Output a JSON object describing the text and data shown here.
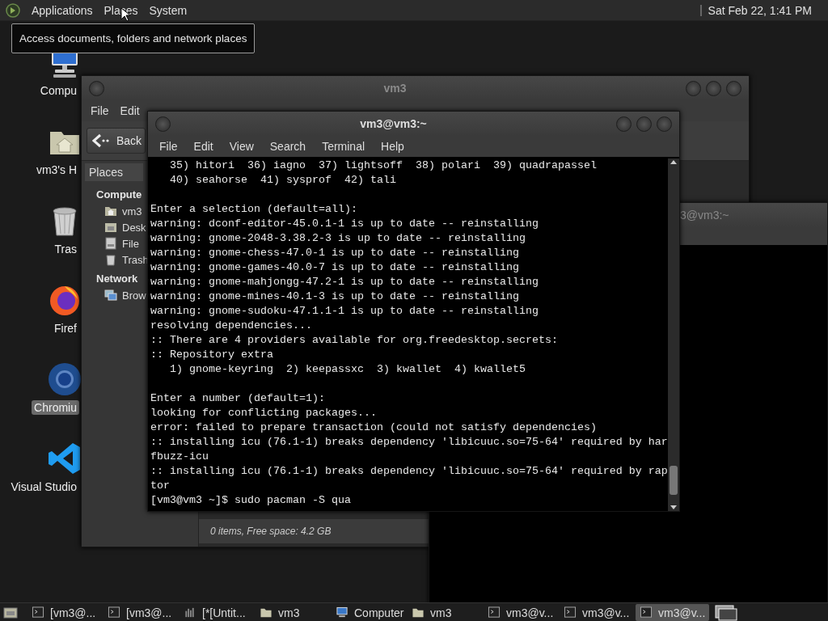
{
  "top_panel": {
    "menus": [
      "Applications",
      "Places",
      "System"
    ],
    "clock": "Sat Feb 22, 1:41 PM"
  },
  "tooltip": {
    "text": "Access documents, folders and network places"
  },
  "desktop_icons": [
    {
      "label": "Compu",
      "kind": "computer",
      "selected": false
    },
    {
      "label": "vm3's H",
      "kind": "home",
      "selected": false
    },
    {
      "label": "Tras",
      "kind": "trash",
      "selected": false
    },
    {
      "label": "Firef",
      "kind": "firefox",
      "selected": false
    },
    {
      "label": "Chromiu",
      "kind": "chromium",
      "selected": true
    },
    {
      "label": "Visual Studio",
      "kind": "vscode",
      "selected": false
    }
  ],
  "file_manager": {
    "title": "vm3",
    "menu": [
      "File",
      "Edit"
    ],
    "back_label": "Back",
    "sidebar_header": "Places",
    "sections": [
      {
        "heading": "Compute",
        "items": [
          {
            "label": "vm3",
            "kind": "home"
          },
          {
            "label": "Desk",
            "kind": "desktop"
          },
          {
            "label": "File",
            "kind": "drive"
          },
          {
            "label": "Trash",
            "kind": "trash"
          }
        ]
      },
      {
        "heading": "Network",
        "items": [
          {
            "label": "Brow",
            "kind": "network"
          }
        ]
      }
    ],
    "status": "0 items, Free space: 4.2 GB"
  },
  "background_terminal": {
    "title": "3@vm3:~"
  },
  "terminal": {
    "title": "vm3@vm3:~",
    "menu": [
      "File",
      "Edit",
      "View",
      "Search",
      "Terminal",
      "Help"
    ],
    "blocks": [
      [
        "   35) hitori  36) iagno  37) lightsoff  38) polari  39) quadrapassel",
        "   40) seahorse  41) sysprof  42) tali"
      ],
      [
        "Enter a selection (default=all):",
        "warning: dconf-editor-45.0.1-1 is up to date -- reinstalling",
        "warning: gnome-2048-3.38.2-3 is up to date -- reinstalling",
        "warning: gnome-chess-47.0-1 is up to date -- reinstalling",
        "warning: gnome-games-40.0-7 is up to date -- reinstalling",
        "warning: gnome-mahjongg-47.2-1 is up to date -- reinstalling",
        "warning: gnome-mines-40.1-3 is up to date -- reinstalling",
        "warning: gnome-sudoku-47.1.1-1 is up to date -- reinstalling",
        "resolving dependencies...",
        ":: There are 4 providers available for org.freedesktop.secrets:",
        ":: Repository extra",
        "   1) gnome-keyring  2) keepassxc  3) kwallet  4) kwallet5"
      ],
      [
        "Enter a number (default=1):",
        "looking for conflicting packages...",
        "error: failed to prepare transaction (could not satisfy dependencies)",
        ":: installing icu (76.1-1) breaks dependency 'libicuuc.so=75-64' required by har",
        "fbuzz-icu",
        ":: installing icu (76.1-1) breaks dependency 'libicuuc.so=75-64' required by rap",
        "tor",
        "[vm3@vm3 ~]$ sudo pacman -S qua"
      ]
    ]
  },
  "taskbar": {
    "items": [
      {
        "label": "[vm3@...",
        "kind": "terminal",
        "selected": false
      },
      {
        "label": "[vm3@...",
        "kind": "terminal",
        "selected": false
      },
      {
        "label": "[*[Untit...",
        "kind": "editor",
        "selected": false
      },
      {
        "label": "vm3",
        "kind": "folder",
        "selected": false
      },
      {
        "label": "Computer",
        "kind": "computer",
        "selected": false
      },
      {
        "label": "vm3",
        "kind": "folder",
        "selected": false
      },
      {
        "label": "vm3@v...",
        "kind": "terminal",
        "selected": false
      },
      {
        "label": "vm3@v...",
        "kind": "terminal",
        "selected": false
      },
      {
        "label": "vm3@v...",
        "kind": "terminal",
        "selected": true
      }
    ]
  }
}
